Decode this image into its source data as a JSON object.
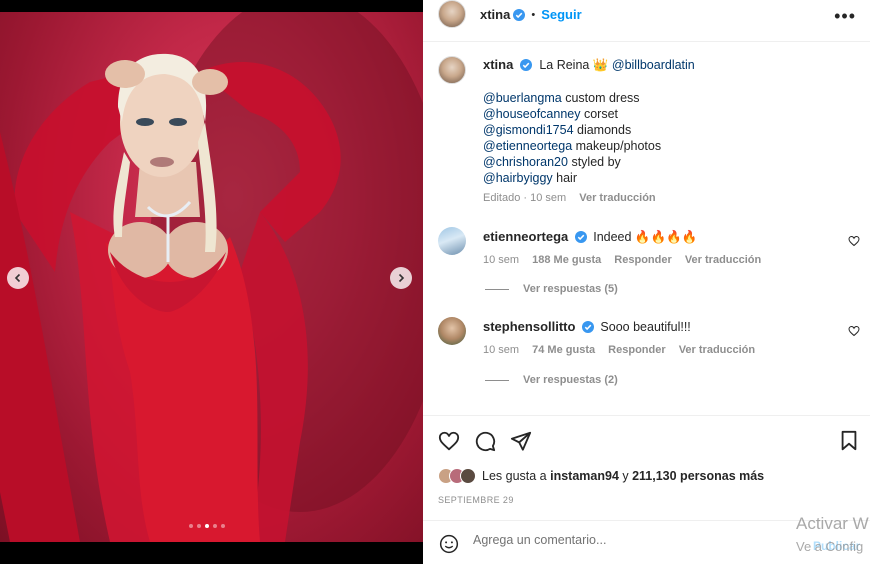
{
  "post": {
    "username": "xtina",
    "follow_label": "Seguir",
    "more_label": "•••",
    "separator": "•"
  },
  "media": {
    "slide_count": 5,
    "active_slide": 3
  },
  "caption": {
    "username": "xtina",
    "headline_text": "La Reina 👑",
    "headline_mention": "@billboardlatin",
    "credits": [
      {
        "mention": "@buerlangma",
        "text": " custom dress"
      },
      {
        "mention": "@houseofcanney",
        "text": " corset"
      },
      {
        "mention": "@gismondi1754",
        "text": " diamonds"
      },
      {
        "mention": "@etienneortega",
        "text": " makeup/photos"
      },
      {
        "mention": "@chrishoran20",
        "text": " styled by"
      },
      {
        "mention": "@hairbyiggy",
        "text": " hair"
      }
    ],
    "edited": "Editado · 10 sem",
    "translate": "Ver traducción"
  },
  "comments": [
    {
      "username": "etienneortega",
      "text": "Indeed 🔥🔥🔥🔥",
      "time": "10 sem",
      "likes": "188 Me gusta",
      "reply": "Responder",
      "translate": "Ver traducción",
      "view_replies": "Ver respuestas (5)"
    },
    {
      "username": "stephensollitto",
      "text": "Sooo beautiful!!!",
      "time": "10 sem",
      "likes": "74 Me gusta",
      "reply": "Responder",
      "translate": "Ver traducción",
      "view_replies": "Ver respuestas (2)"
    }
  ],
  "likes": {
    "prefix": "Les gusta a ",
    "user": "instaman94",
    "middle": " y ",
    "count": "211,130 personas más"
  },
  "date": "SEPTIEMBRE 29",
  "add_comment": {
    "placeholder": "Agrega un comentario...",
    "publish": "Publicar"
  },
  "os_watermark": {
    "line1": "Activar W",
    "line2": "Ve a Config"
  },
  "colors": {
    "accent": "#0095f6",
    "mention": "#00376b",
    "verified": "#3897f0",
    "muted": "#8e8e8e"
  }
}
